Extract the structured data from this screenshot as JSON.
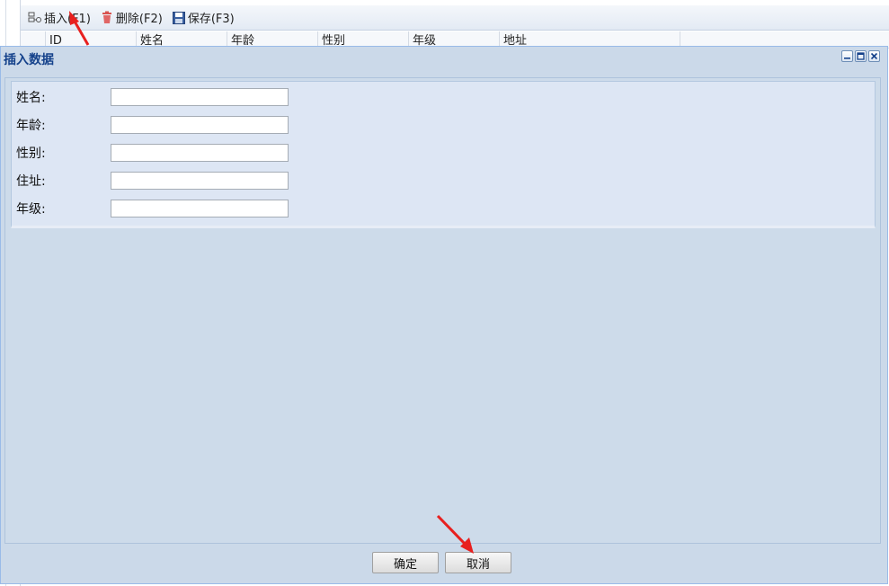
{
  "toolbar": {
    "insert_label": "插入(F1)",
    "delete_label": "删除(F2)",
    "save_label": "保存(F3)"
  },
  "grid": {
    "columns": [
      "ID",
      "姓名",
      "年龄",
      "性别",
      "年级",
      "地址"
    ]
  },
  "dialog": {
    "title": "插入数据",
    "fields": [
      {
        "label": "姓名:",
        "value": ""
      },
      {
        "label": "年龄:",
        "value": ""
      },
      {
        "label": "性别:",
        "value": ""
      },
      {
        "label": "住址:",
        "value": ""
      },
      {
        "label": "年级:",
        "value": ""
      }
    ],
    "ok_label": "确定",
    "cancel_label": "取消"
  },
  "colors": {
    "title": "#15428b",
    "dialog_bg": "#cbd9e9",
    "arrow": "#e8201f"
  },
  "icons": {
    "insert": "insert-row-icon",
    "delete": "trash-icon",
    "save": "floppy-disk-icon",
    "minimize": "minimize-icon",
    "maximize": "maximize-icon",
    "close": "close-icon"
  }
}
